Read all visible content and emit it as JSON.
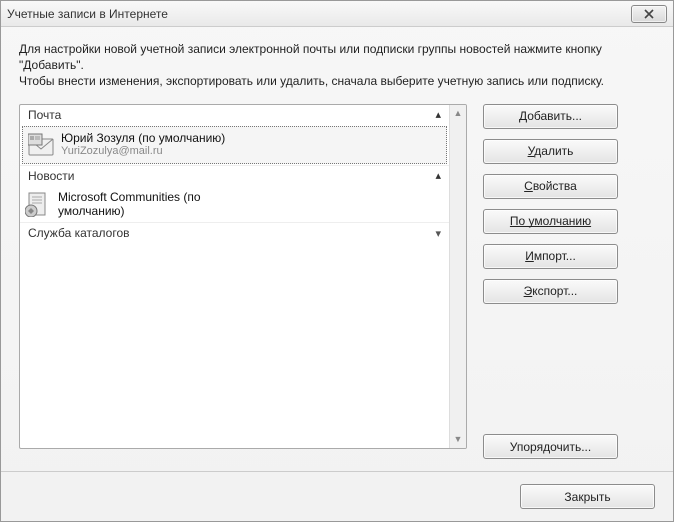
{
  "window": {
    "title": "Учетные записи в Интернете"
  },
  "instructions": {
    "line1": "Для настройки новой учетной записи электронной почты или подписки группы новостей нажмите кнопку \"Добавить\".",
    "line2": "Чтобы внести изменения, экспортировать или удалить, сначала выберите учетную запись или подписку."
  },
  "sections": {
    "mail": {
      "label": "Почта",
      "account_name": "Юрий Зозуля (по умолчанию)",
      "account_email": "YuriZozulya@mail.ru"
    },
    "news": {
      "label": "Новости",
      "account_name": "Microsoft Communities (по умолчанию)"
    },
    "catalog": {
      "label": "Служба каталогов"
    }
  },
  "buttons": {
    "add": "Добавить...",
    "remove": "Удалить",
    "properties": "Свойства",
    "default": "По умолчанию",
    "import": "Импорт...",
    "export": "Экспорт...",
    "arrange": "Упорядочить...",
    "close": "Закрыть"
  }
}
